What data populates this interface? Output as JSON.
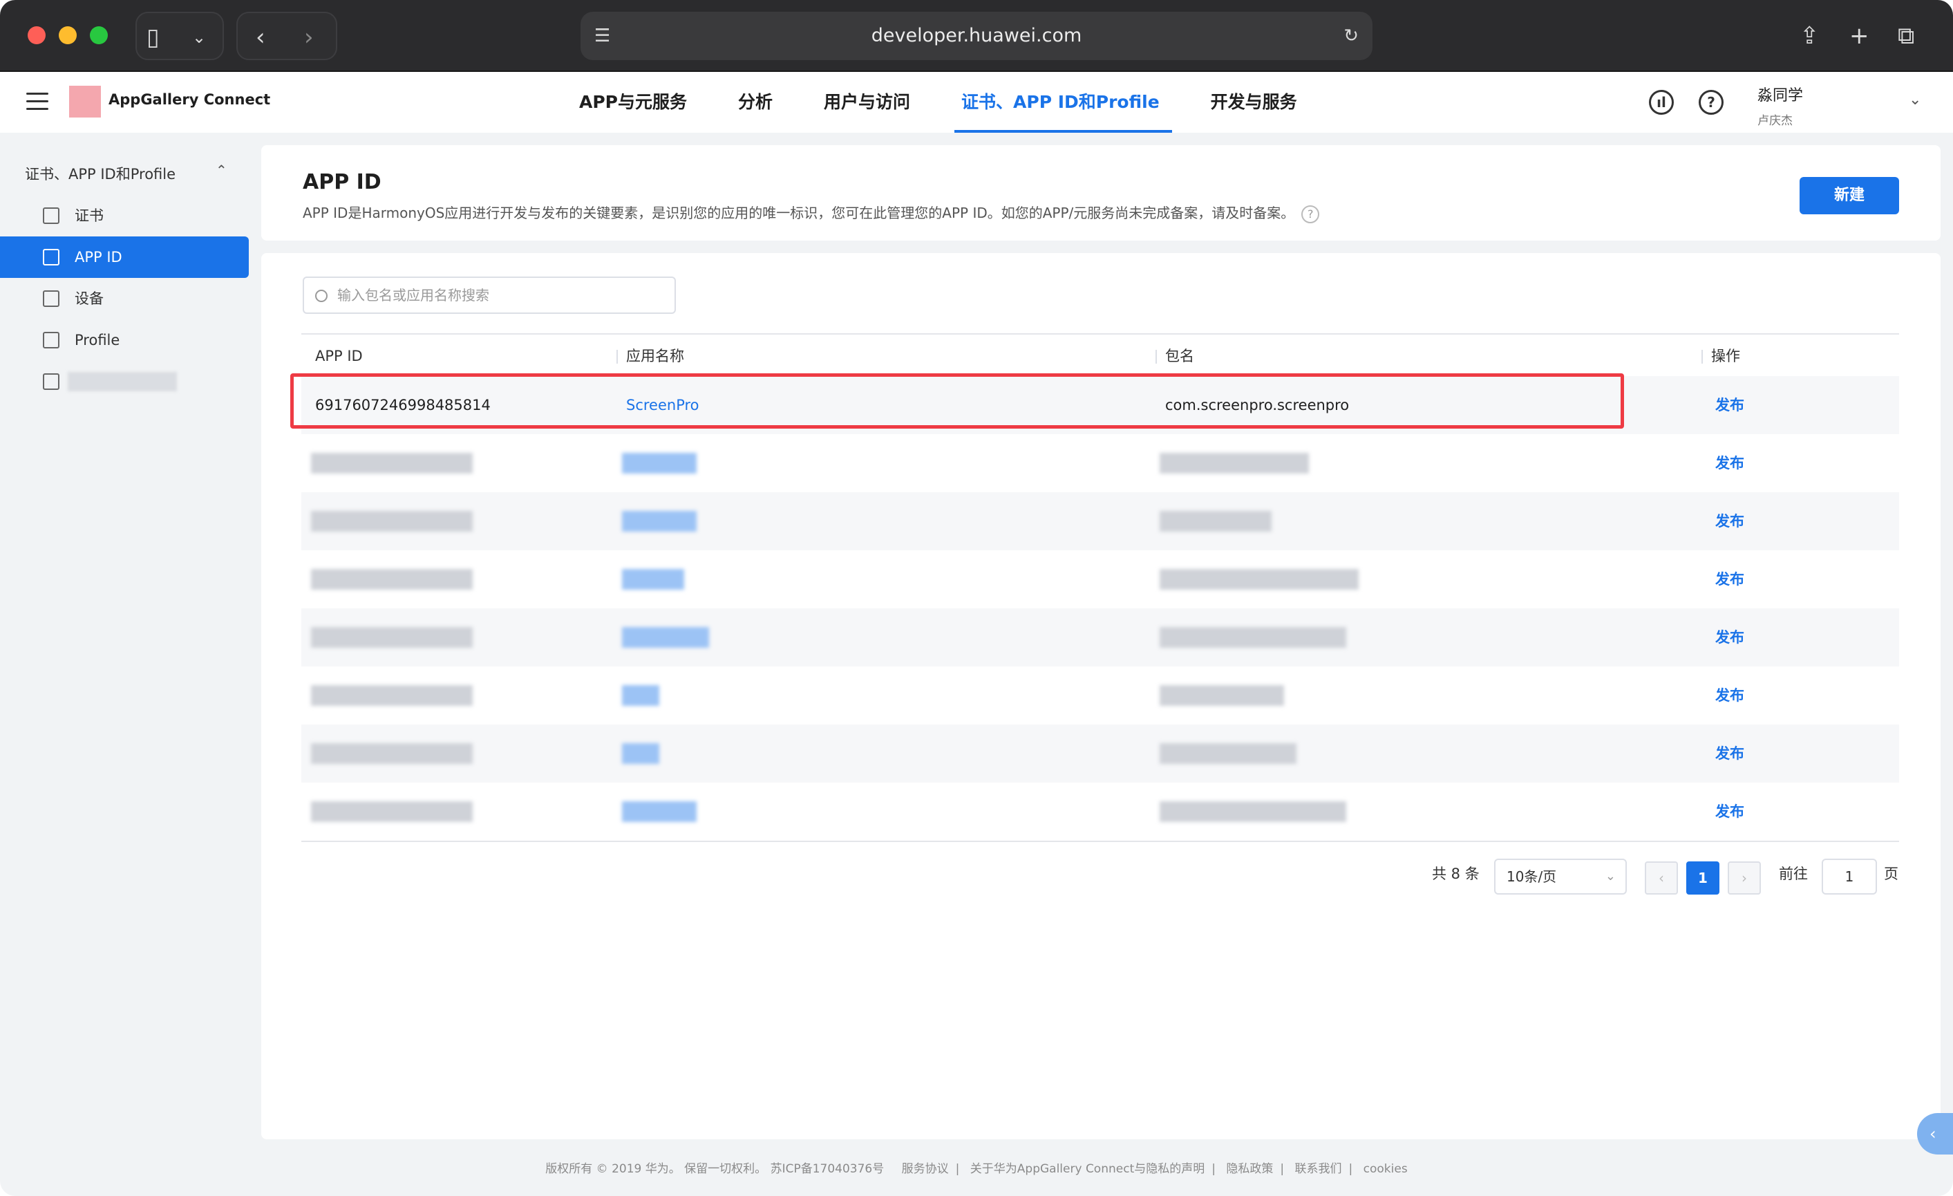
{
  "browser": {
    "url": "developer.huawei.com"
  },
  "header": {
    "brand": "AppGallery Connect",
    "nav": [
      {
        "label": "APP与元服务"
      },
      {
        "label": "分析"
      },
      {
        "label": "用户与访问"
      },
      {
        "label": "证书、APP ID和Profile"
      },
      {
        "label": "开发与服务"
      }
    ],
    "active_nav": "证书、APP ID和Profile",
    "user": {
      "name": "淼同学",
      "sub": "卢庆杰"
    }
  },
  "sidebar": {
    "heading": "证书、APP ID和Profile",
    "items": [
      {
        "label": "证书"
      },
      {
        "label": "APP ID"
      },
      {
        "label": "设备"
      },
      {
        "label": "Profile"
      }
    ],
    "active_item": "APP ID"
  },
  "page": {
    "title": "APP ID",
    "description": "APP ID是HarmonyOS应用进行开发与发布的关键要素，是识别您的应用的唯一标识，您可在此管理您的APP ID。如您的APP/元服务尚未完成备案，请及时备案。",
    "new_button": "新建"
  },
  "search": {
    "placeholder": "输入包名或应用名称搜索"
  },
  "table": {
    "columns": [
      "APP ID",
      "应用名称",
      "包名",
      "操作"
    ],
    "rows": [
      {
        "app_id": "6917607246998485814",
        "app_name": "ScreenPro",
        "package": "com.screenpro.screenpro",
        "action": "发布"
      },
      {
        "action": "发布"
      },
      {
        "action": "发布"
      },
      {
        "action": "发布"
      },
      {
        "action": "发布"
      },
      {
        "action": "发布"
      },
      {
        "action": "发布"
      },
      {
        "action": "发布"
      }
    ]
  },
  "pagination": {
    "total": "共 8 条",
    "page_size": "10条/页",
    "current_page": "1",
    "goto_label": "前往",
    "goto_value": "1",
    "page_suffix": "页"
  },
  "footer": {
    "copyright": "版权所有 © 2019 华为。 保留一切权利。 苏ICP备17040376号",
    "links": [
      "服务协议",
      "关于华为AppGallery Connect与隐私的声明",
      "隐私政策",
      "联系我们",
      "cookies"
    ]
  },
  "colors": {
    "accent": "#1a73e8",
    "highlight": "#ee3b44"
  }
}
